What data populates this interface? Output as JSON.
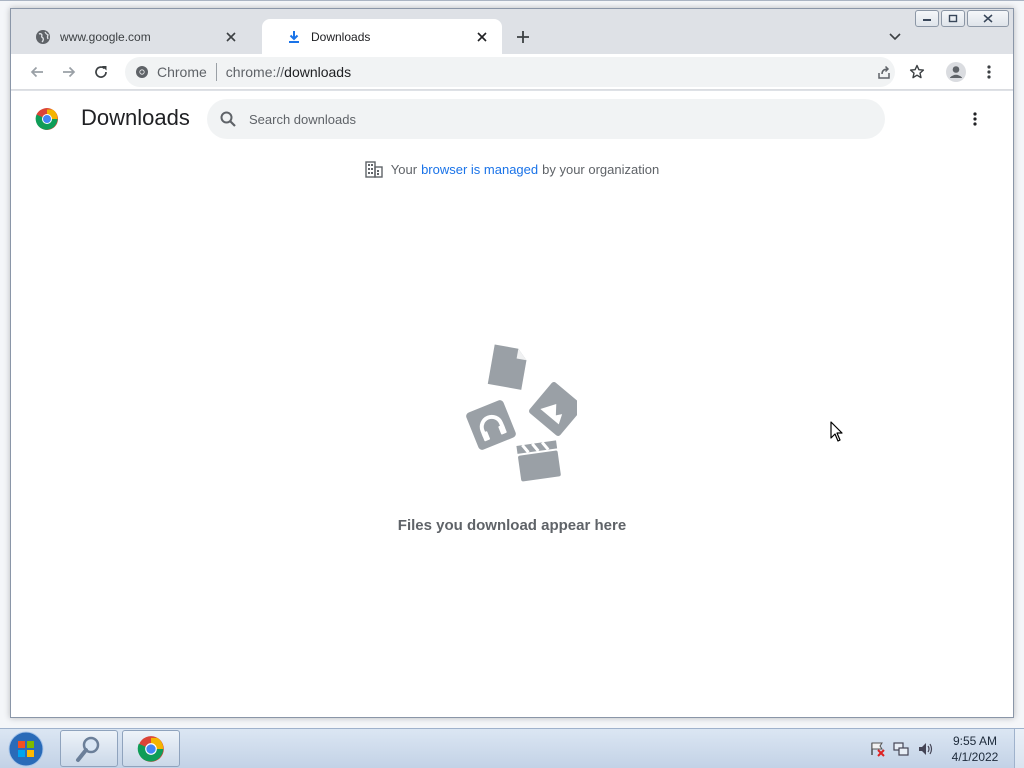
{
  "tabs": [
    {
      "title": "www.google.com",
      "favicon": "globe-icon",
      "active": false
    },
    {
      "title": "Downloads",
      "favicon": "download-icon",
      "active": true
    }
  ],
  "toolbar": {
    "site_label": "Chrome",
    "url_scheme": "chrome://",
    "url_host": "downloads"
  },
  "downloads_page": {
    "title": "Downloads",
    "search_placeholder": "Search downloads",
    "managed_prefix": "Your",
    "managed_link": "browser is managed",
    "managed_suffix": "by your organization",
    "empty_message": "Files you download appear here"
  },
  "taskbar": {
    "time": "9:55 AM",
    "date": "4/1/2022"
  },
  "colors": {
    "accent": "#1a73e8",
    "tab_strip": "#dee1e6",
    "illustration_gray": "#9aa0a6"
  }
}
